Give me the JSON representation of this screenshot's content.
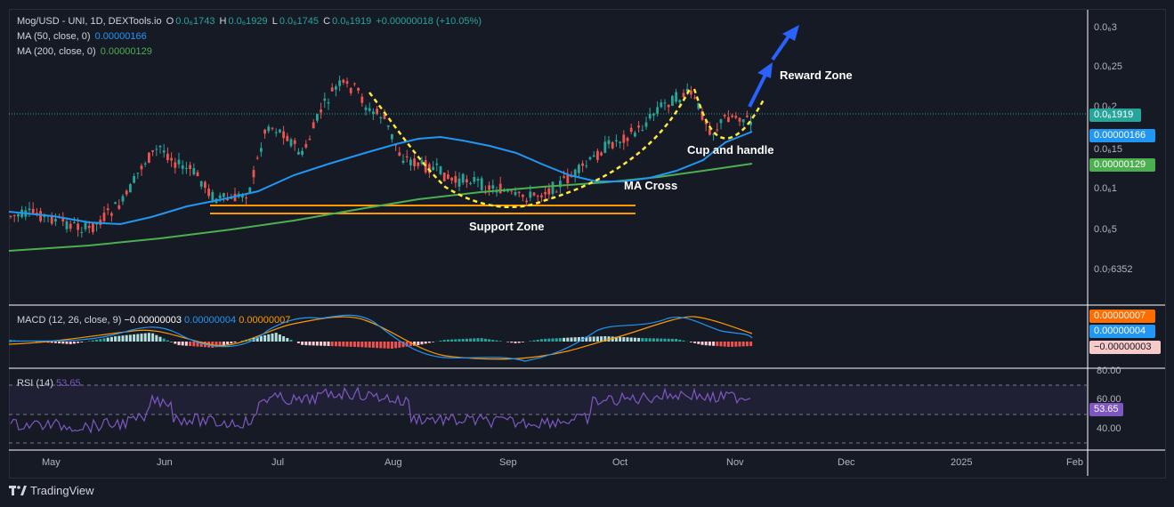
{
  "legend": {
    "symbol": "Mog/USD - UNI, 1D, DEXTools.io",
    "o_label": "O",
    "o_val": "0.0₆1743",
    "h_label": "H",
    "h_val": "0.0₆1929",
    "l_label": "L",
    "l_val": "0.0₆1745",
    "c_label": "C",
    "c_val": "0.0₆1919",
    "change": "+0.00000018 (+10.05%)",
    "ma50_label": "MA (50, close, 0)",
    "ma50_val": "0.00000166",
    "ma200_label": "MA (200, close, 0)",
    "ma200_val": "0.00000129"
  },
  "price_axis": [
    "0.0₆3",
    "0.0₆25",
    "0.0₆2",
    "0.0₆15",
    "0.0₆1",
    "0.0₆5",
    "0.0₇6352"
  ],
  "badges": {
    "price": "0.0₆1919",
    "ma50": "0.00000166",
    "ma200": "0.00000129",
    "macd_signal": "0.00000007",
    "macd_line": "0.00000004",
    "macd_hist": "−0.00000003",
    "rsi": "53.65"
  },
  "macd": {
    "label": "MACD (12, 26, close, 9)",
    "hist": "−0.00000003",
    "macd": "0.00000004",
    "signal": "0.00000007"
  },
  "rsi": {
    "label": "RSI (14)",
    "value": "53.65",
    "levels": [
      "80.00",
      "60.00",
      "40.00"
    ]
  },
  "time_axis": [
    "May",
    "Jun",
    "Jul",
    "Aug",
    "Sep",
    "Oct",
    "Nov",
    "Dec",
    "2025",
    "Feb"
  ],
  "annotations": {
    "reward": "Reward Zone",
    "cup": "Cup and handle",
    "ma_cross": "MA Cross",
    "support": "Support Zone"
  },
  "brand": "TradingView",
  "colors": {
    "up": "#26a69a",
    "down": "#ef5350",
    "ma50": "#2196f3",
    "ma200": "#4caf50",
    "signal": "#ff9800",
    "rsi": "#7e57c2",
    "support": "#ff9800",
    "cup": "#ffeb3b",
    "arrow": "#2962ff"
  }
}
